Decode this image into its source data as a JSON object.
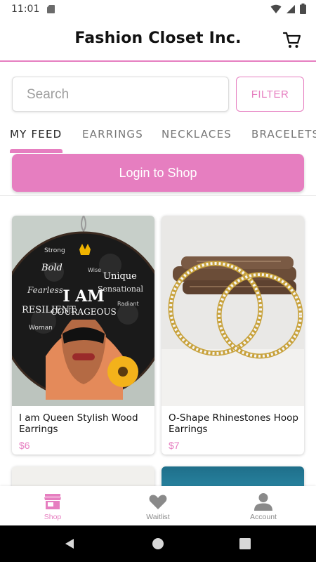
{
  "status_bar": {
    "time": "11:01"
  },
  "app_bar": {
    "title": "Fashion Closet Inc."
  },
  "search": {
    "placeholder": "Search",
    "value": "",
    "filter_label": "FILTER"
  },
  "tabs": [
    {
      "label": "MY FEED",
      "active": true
    },
    {
      "label": "EARRINGS",
      "active": false
    },
    {
      "label": "NECKLACES",
      "active": false
    },
    {
      "label": "BRACELETS",
      "active": false
    }
  ],
  "login": {
    "label": "Login to Shop"
  },
  "products": [
    {
      "name": "I am Queen Stylish Wood Earrings",
      "price": "$6"
    },
    {
      "name": "O-Shape Rhinestones Hoop Earrings",
      "price": "$7"
    }
  ],
  "bottom_nav": [
    {
      "label": "Shop",
      "icon": "store-icon",
      "active": true
    },
    {
      "label": "Waitlist",
      "icon": "heart-icon",
      "active": false
    },
    {
      "label": "Account",
      "icon": "person-icon",
      "active": false
    }
  ],
  "colors": {
    "accent": "#e67ec0",
    "text": "#111111",
    "muted": "#8a8a8a"
  }
}
